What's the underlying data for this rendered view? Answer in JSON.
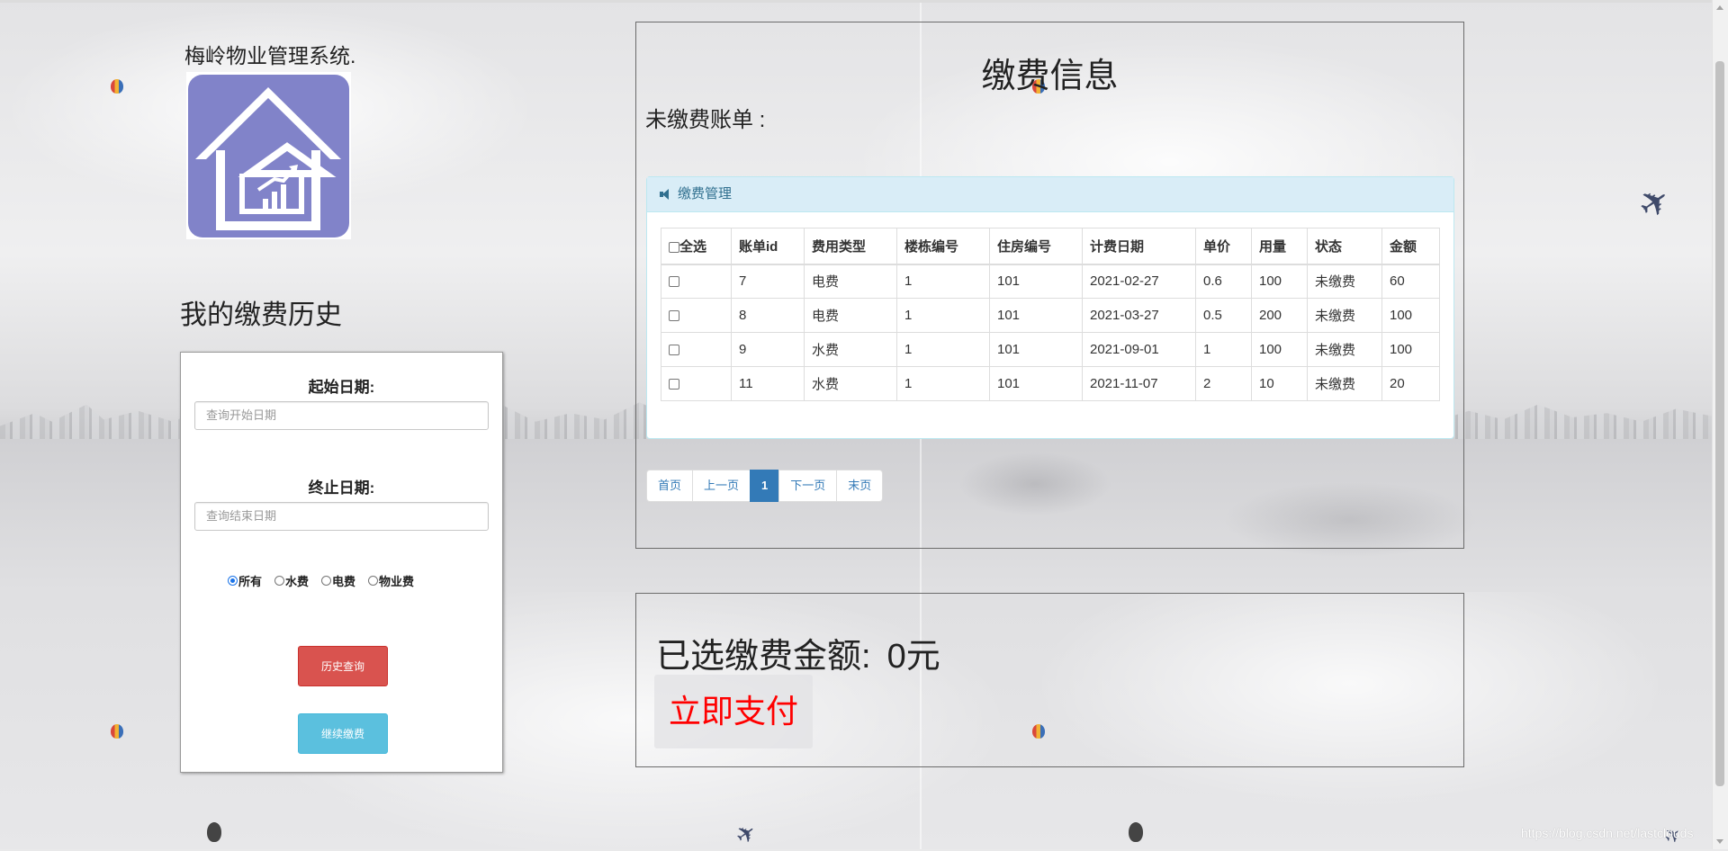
{
  "system": {
    "title": "梅岭物业管理系统."
  },
  "history": {
    "title": "我的缴费历史",
    "start_label": "起始日期:",
    "start_placeholder": "查询开始日期",
    "end_label": "终止日期:",
    "end_placeholder": "查询结束日期",
    "fee_types": [
      {
        "label": "所有",
        "checked": true
      },
      {
        "label": "水费",
        "checked": false
      },
      {
        "label": "电费",
        "checked": false
      },
      {
        "label": "物业费",
        "checked": false
      }
    ],
    "query_button": "历史查询",
    "continue_button": "继续缴费"
  },
  "payment": {
    "title": "缴费信息",
    "unpaid_label": "未缴费账单 :",
    "panel_heading": "缴费管理",
    "columns": [
      "全选",
      "账单id",
      "费用类型",
      "楼栋编号",
      "住房编号",
      "计费日期",
      "单价",
      "用量",
      "状态",
      "金额"
    ],
    "rows": [
      [
        "7",
        "电费",
        "1",
        "101",
        "2021-02-27",
        "0.6",
        "100",
        "未缴费",
        "60"
      ],
      [
        "8",
        "电费",
        "1",
        "101",
        "2021-03-27",
        "0.5",
        "200",
        "未缴费",
        "100"
      ],
      [
        "9",
        "水费",
        "1",
        "101",
        "2021-09-01",
        "1",
        "100",
        "未缴费",
        "100"
      ],
      [
        "11",
        "水费",
        "1",
        "101",
        "2021-11-07",
        "2",
        "10",
        "未缴费",
        "20"
      ]
    ],
    "pager": {
      "first": "首页",
      "prev": "上一页",
      "current": "1",
      "next": "下一页",
      "last": "末页"
    }
  },
  "summary": {
    "selected_label": "已选缴费金额:",
    "selected_amount": "0元",
    "pay_button": "立即支付"
  },
  "watermark": "https://blog.csdn.net/lastclouds",
  "colors": {
    "accent": "#337ab7",
    "danger": "#d9534f",
    "info": "#5bc0de",
    "pay_text": "#ff0000",
    "logo_bg": "#8183c9"
  }
}
